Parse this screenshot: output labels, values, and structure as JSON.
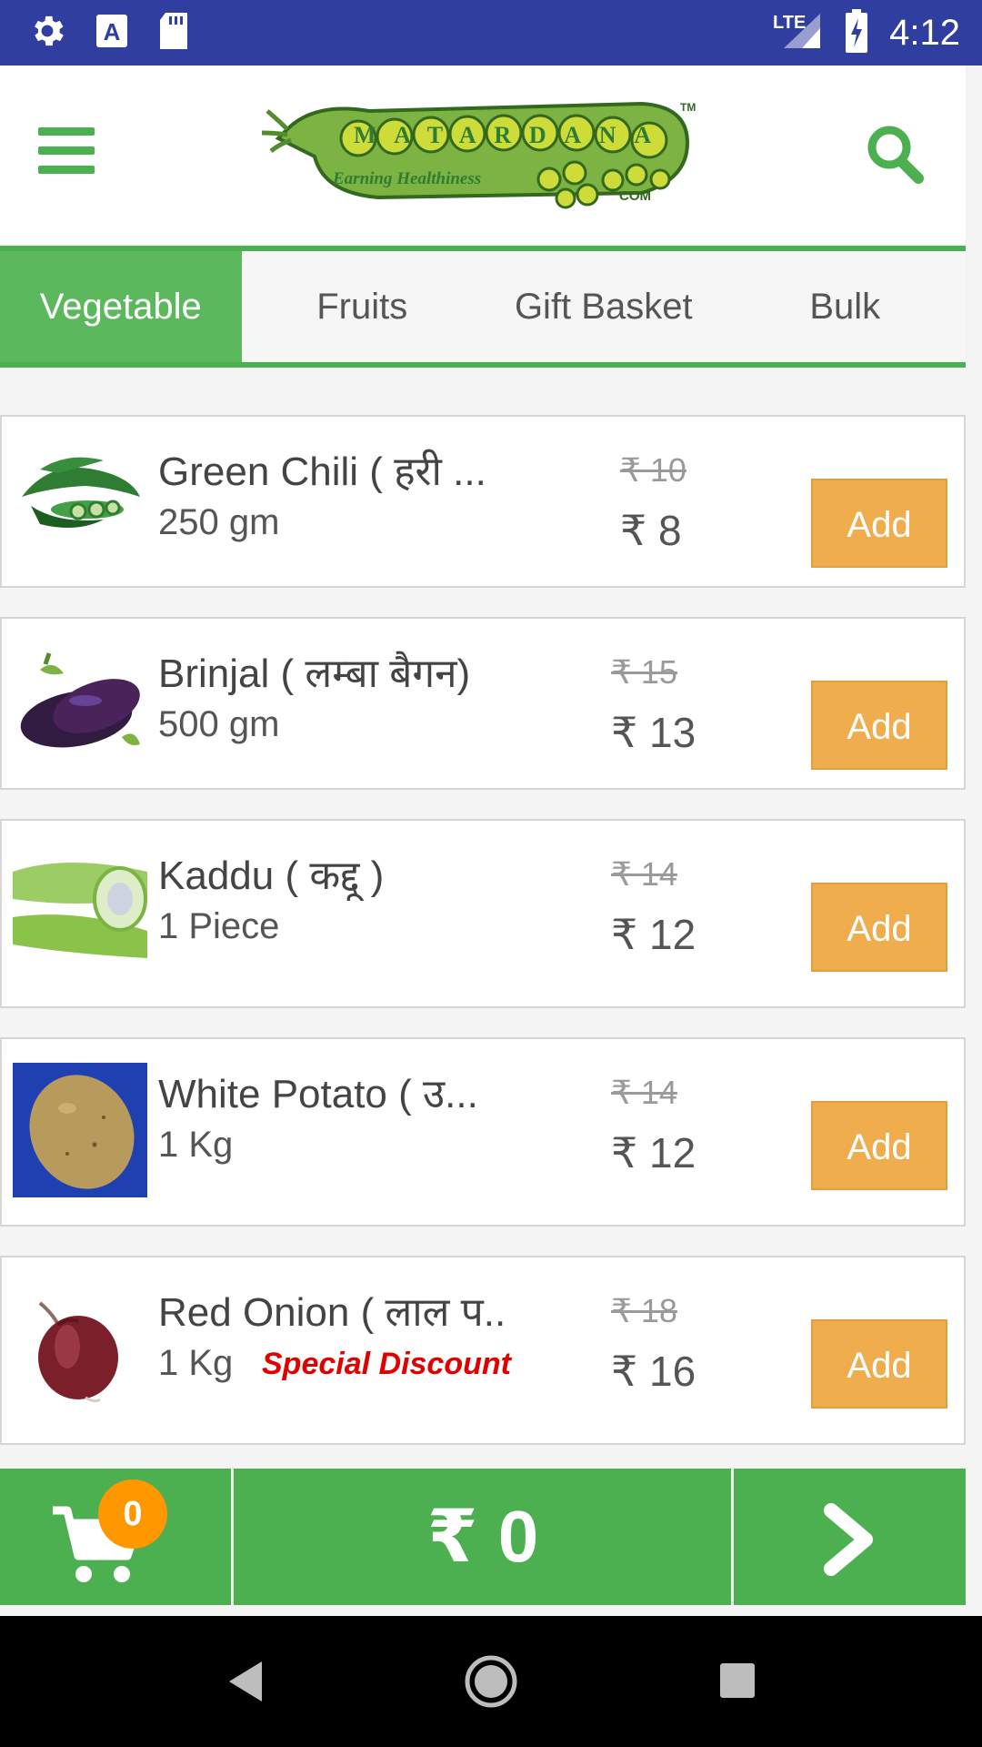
{
  "status_bar": {
    "time": "4:12",
    "network": "LTE"
  },
  "header": {
    "logo_text": "MATARDANA",
    "logo_tagline": "Earning Healthiness",
    "logo_suffix": "COM",
    "trademark": "TM"
  },
  "tabs": [
    {
      "label": "Vegetable",
      "active": true
    },
    {
      "label": "Fruits",
      "active": false
    },
    {
      "label": "Gift Basket",
      "active": false
    },
    {
      "label": "Bulk",
      "active": false
    }
  ],
  "products": [
    {
      "name": "Green Chili ( हरी ...",
      "qty": "250 gm",
      "old_price": "₹ 10",
      "price": "₹ 8",
      "add_label": "Add",
      "image": "green-chili"
    },
    {
      "name": "Brinjal ( लम्बा बैगन)",
      "qty": "500 gm",
      "old_price": "₹ 15",
      "price": "₹ 13",
      "add_label": "Add",
      "image": "brinjal"
    },
    {
      "name": "Kaddu ( कद्दू )",
      "qty": "1 Piece",
      "old_price": "₹ 14",
      "price": "₹ 12",
      "add_label": "Add",
      "image": "bottle-gourd"
    },
    {
      "name": "White Potato ( उ...",
      "qty": "1 Kg",
      "old_price": "₹ 14",
      "price": "₹ 12",
      "add_label": "Add",
      "image": "potato"
    },
    {
      "name": "Red Onion ( लाल प..",
      "qty": "1 Kg",
      "special": "Special Discount",
      "old_price": "₹ 18",
      "price": "₹ 16",
      "add_label": "Add",
      "image": "red-onion"
    }
  ],
  "cart": {
    "count": "0",
    "total": "₹ 0"
  },
  "colors": {
    "primary": "#4caf50",
    "status_bar": "#303f9f",
    "add_button": "#f0ad4e",
    "badge": "#ff9800",
    "special": "#e00000"
  }
}
